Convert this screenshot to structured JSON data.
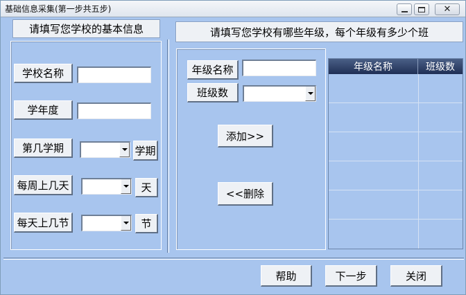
{
  "window": {
    "title": "基础信息采集(第一步共五步)"
  },
  "left": {
    "header": "请填写您学校的基本信息",
    "school_name_label": "学校名称",
    "school_year_label": "学年度",
    "semester_label": "第几学期",
    "semester_unit": "学期",
    "days_per_week_label": "每周上几天",
    "days_unit": "天",
    "periods_per_day_label": "每天上几节",
    "periods_unit": "节"
  },
  "right": {
    "header": "请填写您学校有哪些年级，每个年级有多少个班",
    "grade_name_label": "年级名称",
    "class_count_label": "班级数",
    "add_button": "添加>>",
    "delete_button": "<<删除",
    "grid_columns": [
      "年级名称",
      "班级数"
    ]
  },
  "footer": {
    "help_button": "帮助",
    "next_button": "下一步",
    "close_button": "关闭"
  },
  "colors": {
    "background": "#a8c5ee",
    "grid_header": "#2a3b62"
  },
  "icons": {
    "minimize": "minimize-icon",
    "maximize": "maximize-icon",
    "close": "close-icon",
    "dropdown": "chevron-down-icon"
  }
}
